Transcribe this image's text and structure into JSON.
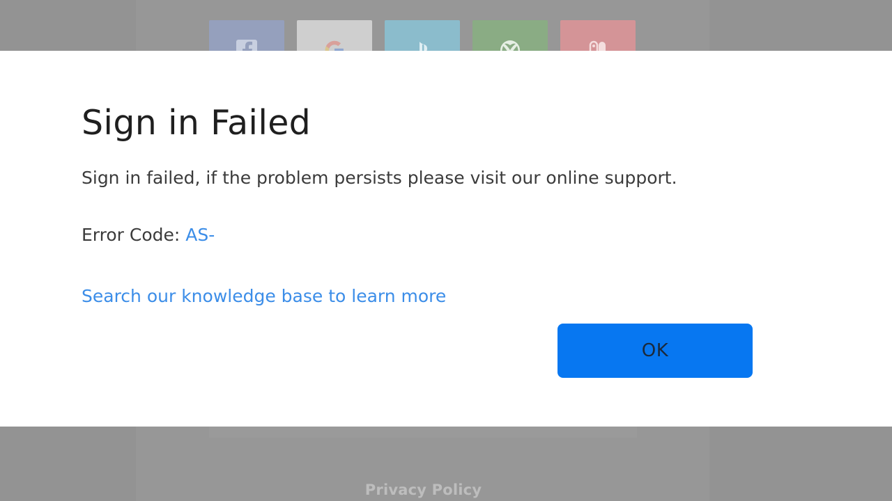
{
  "background": {
    "providers": [
      {
        "name": "Facebook",
        "icon": "facebook-icon",
        "color": "#95a0bd"
      },
      {
        "name": "Google",
        "icon": "google-icon",
        "color": "#cfcfcf"
      },
      {
        "name": "PlayStation",
        "icon": "playstation-icon",
        "color": "#8bbccc"
      },
      {
        "name": "Xbox",
        "icon": "xbox-icon",
        "color": "#8aac84"
      },
      {
        "name": "Nintendo Switch",
        "icon": "nintendo-switch-icon",
        "color": "#d49497"
      }
    ],
    "privacy_label": "Privacy Policy"
  },
  "dialog": {
    "title": "Sign in Failed",
    "message": "Sign in failed, if the problem persists please visit our online support.",
    "error_label": "Error Code:",
    "error_code": "AS-",
    "kb_link": "Search our knowledge base to learn more",
    "ok_label": "OK"
  },
  "colors": {
    "overlay": "#939393",
    "link": "#3b8de8",
    "button": "#0777f1"
  }
}
